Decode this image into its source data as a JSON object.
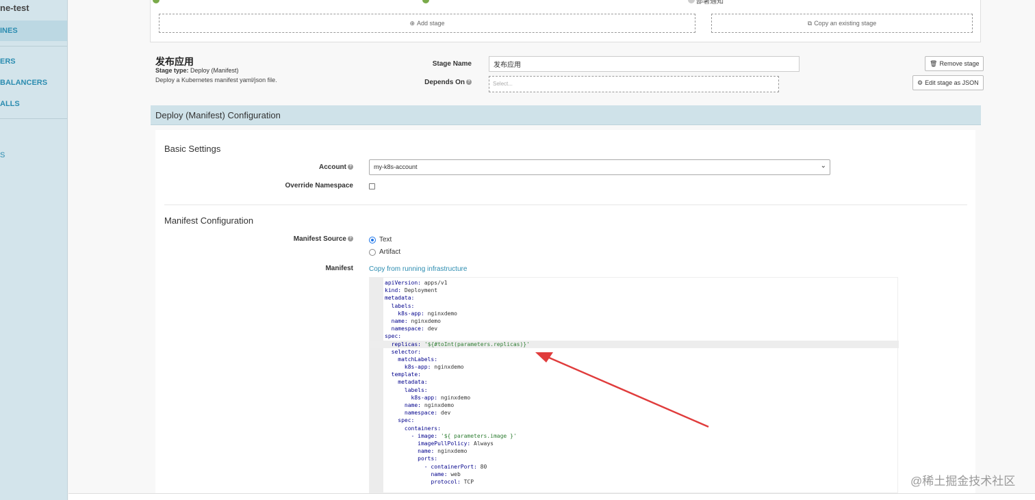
{
  "sidebar": {
    "app_name": "ne-test",
    "items": [
      {
        "label": "INES",
        "active": true
      },
      {
        "label": "ERS"
      },
      {
        "label": "BALANCERS"
      },
      {
        "label": "ALLS"
      },
      {
        "label": "S"
      }
    ]
  },
  "stage_graph": {
    "node_label": "部署通知",
    "add_stage": "Add stage",
    "copy_stage": "Copy an existing stage"
  },
  "stage": {
    "title": "发布应用",
    "type_label": "Stage type:",
    "type_value": "Deploy (Manifest)",
    "description": "Deploy a Kubernetes manifest yaml/json file.",
    "name_label": "Stage Name",
    "name_value": "发布应用",
    "depends_label": "Depends On",
    "depends_placeholder": "Select...",
    "remove_button": "Remove stage",
    "edit_json_button": "Edit stage as JSON"
  },
  "config": {
    "header": "Deploy (Manifest) Configuration",
    "basic_title": "Basic Settings",
    "account_label": "Account",
    "account_value": "my-k8s-account",
    "override_label": "Override Namespace",
    "manifest_title": "Manifest Configuration",
    "source_label": "Manifest Source",
    "source_options": [
      "Text",
      "Artifact"
    ],
    "source_selected": "Text",
    "manifest_label": "Manifest",
    "copy_link": "Copy from running infrastructure"
  },
  "manifest_lines": [
    {
      "indent": 0,
      "key": "apiVersion",
      "value": "apps/v1"
    },
    {
      "indent": 0,
      "key": "kind",
      "value": "Deployment"
    },
    {
      "indent": 0,
      "key": "metadata",
      "value": ""
    },
    {
      "indent": 1,
      "key": "labels",
      "value": ""
    },
    {
      "indent": 2,
      "key": "k8s-app",
      "value": "nginxdemo"
    },
    {
      "indent": 1,
      "key": "name",
      "value": "nginxdemo"
    },
    {
      "indent": 1,
      "key": "namespace",
      "value": "dev"
    },
    {
      "indent": 0,
      "key": "spec",
      "value": ""
    },
    {
      "indent": 1,
      "key": "replicas",
      "value": "'${#toInt(parameters.replicas)}'",
      "highlight": true,
      "string": true
    },
    {
      "indent": 1,
      "key": "selector",
      "value": ""
    },
    {
      "indent": 2,
      "key": "matchLabels",
      "value": ""
    },
    {
      "indent": 3,
      "key": "k8s-app",
      "value": "nginxdemo"
    },
    {
      "indent": 1,
      "key": "template",
      "value": ""
    },
    {
      "indent": 2,
      "key": "metadata",
      "value": ""
    },
    {
      "indent": 3,
      "key": "labels",
      "value": ""
    },
    {
      "indent": 4,
      "key": "k8s-app",
      "value": "nginxdemo"
    },
    {
      "indent": 3,
      "key": "name",
      "value": "nginxdemo"
    },
    {
      "indent": 3,
      "key": "namespace",
      "value": "dev"
    },
    {
      "indent": 2,
      "key": "spec",
      "value": ""
    },
    {
      "indent": 3,
      "key": "containers",
      "value": ""
    },
    {
      "indent": 4,
      "key": "- image",
      "value": "'${ parameters.image }'",
      "string": true
    },
    {
      "indent": 5,
      "key": "imagePullPolicy",
      "value": "Always"
    },
    {
      "indent": 5,
      "key": "name",
      "value": "nginxdemo"
    },
    {
      "indent": 5,
      "key": "ports",
      "value": ""
    },
    {
      "indent": 6,
      "key": "- containerPort",
      "value": "80"
    },
    {
      "indent": 7,
      "key": "name",
      "value": "web"
    },
    {
      "indent": 7,
      "key": "protocol",
      "value": "TCP"
    }
  ],
  "watermark": "@稀土掘金技术社区",
  "colors": {
    "accent": "#2b8cb0",
    "header_bg": "#cfe2e9",
    "arrow": "#e03c3c"
  }
}
